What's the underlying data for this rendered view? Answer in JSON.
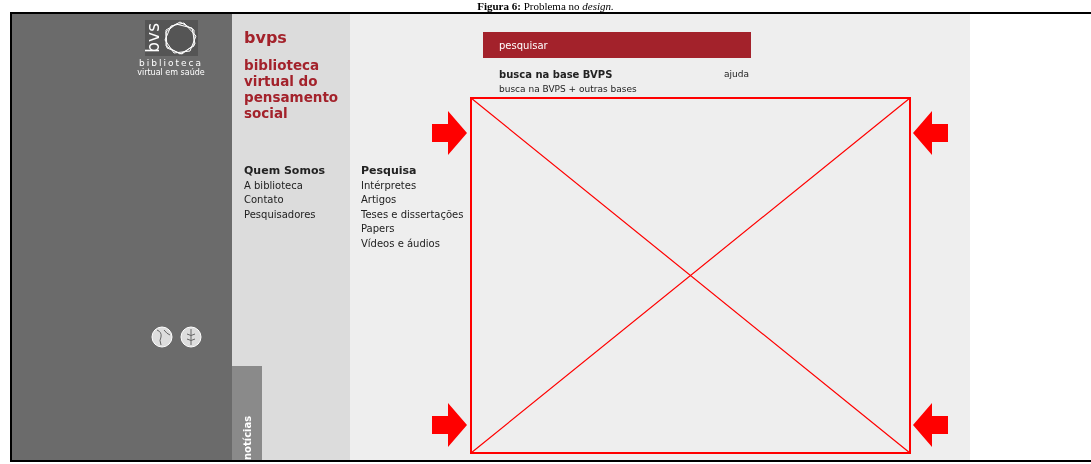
{
  "caption": "**Figura 6:** Problema no *design.*",
  "logo": {
    "abbr": "bvs",
    "name": "biblioteca",
    "subtitle": "virtual em saúde"
  },
  "site": {
    "title": "bvps",
    "subtitle": "biblioteca virtual do pensamento social"
  },
  "menus": [
    {
      "heading": "Quem Somos",
      "items": [
        "A biblioteca",
        "Contato",
        "Pesquisadores"
      ]
    },
    {
      "heading": "Pesquisa",
      "items": [
        "Intérpretes",
        "Artigos",
        "Teses e dissertações",
        "Papers",
        "Vídeos e áudios"
      ]
    }
  ],
  "search": {
    "button": "pesquisar",
    "help": "ajuda",
    "options": [
      {
        "label": "busca na base BVPS",
        "selected": true
      },
      {
        "label": "busca na BVPS + outras bases",
        "selected": false
      }
    ]
  },
  "news_tab": "notícias"
}
